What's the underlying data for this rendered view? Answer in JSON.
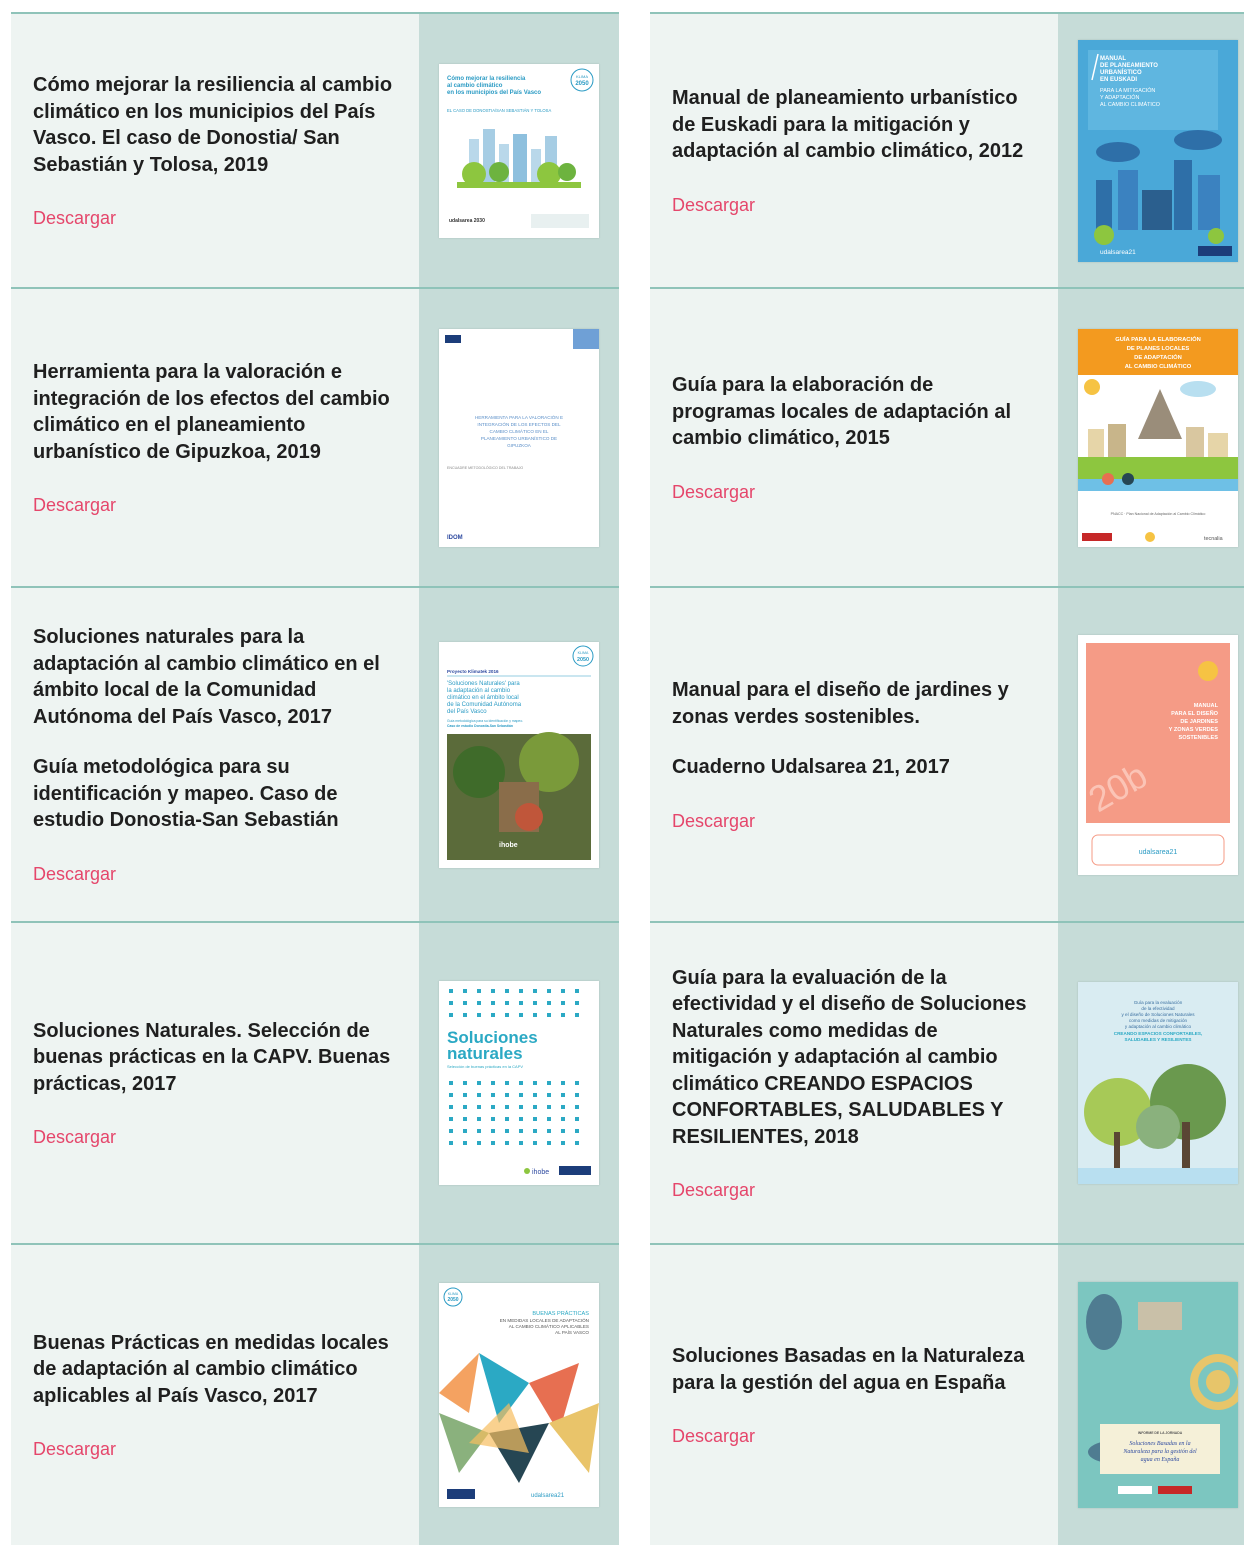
{
  "download_label": "Descargar",
  "left": [
    {
      "title": "Cómo mejorar la resiliencia al cambio climático en los municipios del País Vasco. El caso de Donostia/ San Sebastián y Tolosa, 2019",
      "subtitle": ""
    },
    {
      "title": "Herramienta para la valoración e integración de los efectos del cambio climático en el planeamiento urbanístico de Gipuzkoa, 2019",
      "subtitle": ""
    },
    {
      "title": "Soluciones naturales para la adaptación al cambio climático en el ámbito local de la Comunidad Autónoma del País Vasco, 2017",
      "subtitle": "Guía metodológica para su identificación y mapeo. Caso de estudio Donostia-San Sebastián"
    },
    {
      "title": "Soluciones Naturales. Selección de buenas prácticas en la CAPV. Buenas prácticas, 2017",
      "subtitle": ""
    },
    {
      "title": "Buenas Prácticas en medidas locales de adaptación al cambio climático aplicables al País Vasco, 2017",
      "subtitle": ""
    }
  ],
  "right": [
    {
      "title": "Manual de planeamiento urbanístico de Euskadi para la mitigación y adaptación al cambio climático, 2012",
      "subtitle": ""
    },
    {
      "title": "Guía para la elaboración de programas locales de adaptación al cambio climático, 2015",
      "subtitle": ""
    },
    {
      "title": "Manual para el diseño de jardines y zonas verdes sostenibles.",
      "subtitle": "Cuaderno Udalsarea 21, 2017"
    },
    {
      "title": "Guía para la evaluación de la efectividad y el diseño de Soluciones Naturales como medidas de mitigación y adaptación al cambio climático CREANDO ESPACIOS CONFORTABLES, SALUDABLES Y RESILIENTES, 2018",
      "subtitle": ""
    },
    {
      "title": "Soluciones Basadas en la Naturaleza para la gestión del agua en España",
      "subtitle": ""
    }
  ],
  "covers": {
    "c1": {
      "line1": "Cómo mejorar la resiliencia",
      "line2": "al cambio climático",
      "line3": "en los municipios del País Vasco",
      "sub": "EL CASO DE DONOSTIA/SAN SEBASTIÁN Y TOLOSA",
      "badge_top": "KLIMA",
      "badge_num": "2050",
      "footer": "udalsarea 2030"
    },
    "c2": {
      "line1": "HERRAMIENTA PARA LA VALORACIÓN E",
      "line2": "INTEGRACIÓN DE LOS EFECTOS DEL",
      "line3": "CAMBIO CLIMÁTICO EN EL",
      "line4": "PLANEAMIENTO URBANÍSTICO DE",
      "line5": "GIPUZKOA",
      "sub": "ENCUADRE METODOLÓGICO DEL TRABAJO",
      "footer": "IDOM"
    },
    "c3": {
      "project": "Proyecto Klimatek 2016",
      "line1": "'Soluciones Naturales' para",
      "line2": "la adaptación al cambio",
      "line3": "climático en el ámbito local",
      "line4": "de la Comunidad Autónoma",
      "line5": "del País Vasco",
      "sub1": "Guía metodológica para su identificación y mapeo.",
      "sub2": "Caso de estudio Donostia-San Sebastián",
      "footer": "ihobe",
      "badge_top": "KLIMA",
      "badge_num": "2050"
    },
    "c4": {
      "line1": "Soluciones",
      "line2": "naturales",
      "sub": "Selección de buenas prácticas en la CAPV",
      "footer": "ihobe"
    },
    "c5": {
      "line1": "BUENAS PRÁCTICAS",
      "line2": "EN MEDIDAS LOCALES DE ADAPTACIÓN",
      "line3": "AL CAMBIO CLIMÁTICO APLICABLES",
      "line4": "AL PAÍS VASCO",
      "badge_top": "KLIMA",
      "badge_num": "2050",
      "footer": "udalsarea21"
    },
    "c6": {
      "line1": "MANUAL",
      "line2": "DE PLANEAMIENTO",
      "line3": "URBANÍSTICO",
      "line4": "EN EUSKADI",
      "line5": "PARA LA MITIGACIÓN",
      "line6": "Y ADAPTACIÓN",
      "line7": "AL CAMBIO CLIMÁTICO",
      "footer": "udalsarea21"
    },
    "c7": {
      "line1": "GUÍA PARA LA ELABORACIÓN",
      "line2": "DE PLANES LOCALES",
      "line3": "DE ADAPTACIÓN",
      "line4": "AL CAMBIO CLIMÁTICO",
      "sub": "PNACC · Plan Nacional de Adaptación al Cambio Climático",
      "footer": "tecnalia"
    },
    "c8": {
      "line1": "MANUAL",
      "line2": "PARA EL DISEÑO",
      "line3": "DE JARDINES",
      "line4": "Y ZONAS VERDES",
      "line5": "SOSTENIBLES",
      "num": "20b",
      "footer": "udalsarea21"
    },
    "c9": {
      "line1": "Guía para la evaluación",
      "line2": "de la efectividad",
      "line3": "y el diseño de Soluciones Naturales",
      "line4": "como medidas de mitigación",
      "line5": "y adaptación al cambio climático",
      "line6": "CREANDO ESPACIOS CONFORTABLES,",
      "line7": "SALUDABLES Y RESILIENTES"
    },
    "c10": {
      "label": "INFORME DE LA JORNADA",
      "line1": "Soluciones Basadas en la",
      "line2": "Naturaleza para la gestión del",
      "line3": "agua en España"
    }
  }
}
